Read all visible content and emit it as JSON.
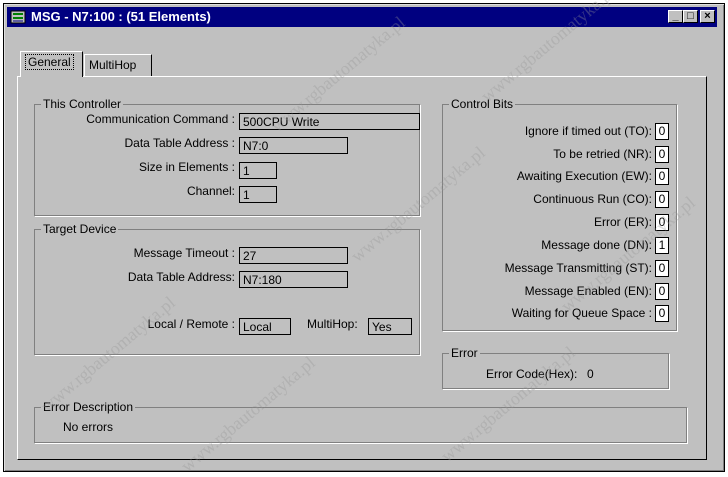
{
  "window": {
    "title": "MSG - N7:100 : (51 Elements)",
    "buttons": {
      "minimize": "_",
      "maximize": "□",
      "close": "×"
    }
  },
  "tabs": [
    {
      "label": "General",
      "active": true
    },
    {
      "label": "MultiHop",
      "active": false
    }
  ],
  "this_controller": {
    "title": "This Controller",
    "communication_command_label": "Communication Command :",
    "communication_command_value": "500CPU Write",
    "data_table_address_label": "Data Table Address :",
    "data_table_address_value": "N7:0",
    "size_in_elements_label": "Size in Elements :",
    "size_in_elements_value": "1",
    "channel_label": "Channel:",
    "channel_value": "1"
  },
  "target_device": {
    "title": "Target Device",
    "message_timeout_label": "Message Timeout :",
    "message_timeout_value": "27",
    "data_table_address_label": "Data Table Address:",
    "data_table_address_value": "N7:180",
    "local_remote_label": "Local / Remote :",
    "local_remote_value": "Local",
    "multihop_label": "MultiHop:",
    "multihop_value": "Yes"
  },
  "control_bits": {
    "title": "Control Bits",
    "items": [
      {
        "label": "Ignore if timed out (TO):",
        "value": "0"
      },
      {
        "label": "To be retried (NR):",
        "value": "0"
      },
      {
        "label": "Awaiting Execution (EW):",
        "value": "0"
      },
      {
        "label": "Continuous Run (CO):",
        "value": "0"
      },
      {
        "label": "Error (ER):",
        "value": "0"
      },
      {
        "label": "Message done (DN):",
        "value": "1"
      },
      {
        "label": "Message Transmitting (ST):",
        "value": "0"
      },
      {
        "label": "Message Enabled (EN):",
        "value": "0"
      },
      {
        "label": "Waiting for Queue Space :",
        "value": "0"
      }
    ]
  },
  "error": {
    "title": "Error",
    "code_label": "Error Code(Hex):",
    "code_value": "0"
  },
  "error_description": {
    "title": "Error Description",
    "text": "No errors"
  },
  "watermark": "www.rgbautomatyka.pl",
  "colors": {
    "titlebar": "#000080",
    "face": "#c0c0c0"
  }
}
